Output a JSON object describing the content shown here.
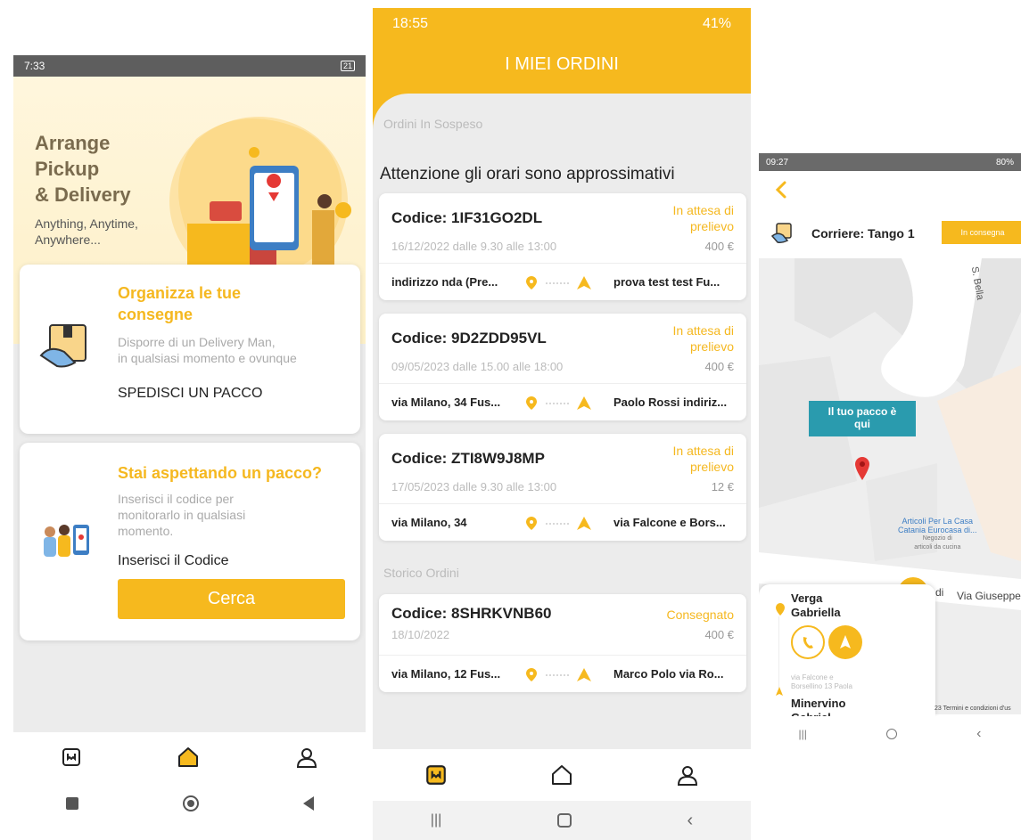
{
  "colors": {
    "accent": "#f6b91e",
    "tooltip": "#2a9bae",
    "pin": "#e53935"
  },
  "phone1": {
    "status": {
      "time": "7:33",
      "right": "21"
    },
    "hero": {
      "title_l1": "Arrange",
      "title_l2": "Pickup",
      "title_l3": "& Delivery",
      "sub_l1": "Anything, Anytime,",
      "sub_l2": "Anywhere..."
    },
    "card1": {
      "title_l1": "Organizza le tue",
      "title_l2": "consegne",
      "desc_l1": "Disporre di un Delivery Man,",
      "desc_l2": "in qualsiasi momento e ovunque",
      "cta": "SPEDISCI UN PACCO"
    },
    "card2": {
      "title": "Stai aspettando un pacco?",
      "desc_l1": "Inserisci il codice per",
      "desc_l2": "monitorarlo in qualsiasi",
      "desc_l3": "momento.",
      "input_label": "Inserisci il Codice",
      "button": "Cerca"
    },
    "tabs": [
      "orders-icon",
      "home-icon",
      "profile-icon"
    ]
  },
  "phone2": {
    "status": {
      "time": "18:55",
      "right": "41%"
    },
    "title": "I MIEI ORDINI",
    "pending_label": "Ordini In Sospeso",
    "notice": "Attenzione gli orari sono approssimativi",
    "history_label": "Storico Ordini",
    "orders": [
      {
        "code": "Codice: 1IF31GO2DL",
        "status_l1": "In attesa di",
        "status_l2": "prelievo",
        "date": "16/12/2022 dalle 9.30 alle 13:00",
        "price": "400 €",
        "from": "indirizzo nda (Pre...",
        "to": "prova test test Fu..."
      },
      {
        "code": "Codice: 9D2ZDD95VL",
        "status_l1": "In attesa di",
        "status_l2": "prelievo",
        "date": "09/05/2023 dalle 15.00 alle 18:00",
        "price": "400 €",
        "from": "via Milano, 34 Fus...",
        "to": "Paolo Rossi indiriz..."
      },
      {
        "code": "Codice: ZTI8W9J8MP",
        "status_l1": "In attesa di",
        "status_l2": "prelievo",
        "date": "17/05/2023 dalle 9.30 alle 13:00",
        "price": "12 €",
        "from": "via Milano, 34",
        "to": "via Falcone e Bors..."
      }
    ],
    "history": [
      {
        "code": "Codice: 8SHRKVNB60",
        "status": "Consegnato",
        "date": "18/10/2022",
        "price": "400 €",
        "from": "via Milano, 12 Fus...",
        "to": "Marco Polo via Ro..."
      }
    ]
  },
  "phone3": {
    "status": {
      "time": "09:27",
      "right": "80%"
    },
    "courier": "Corriere: Tango 1",
    "badge": "In consegna",
    "map": {
      "tooltip_l1": "Il tuo pacco è",
      "tooltip_l2": "qui",
      "street_top": "S. Bella",
      "street_bottom": "Via Giuseppe",
      "street_di": "di",
      "poi_l1": "Articoli Per La Casa",
      "poi_l2": "Catania Eurocasa di...",
      "poi_l3": "Negozio di",
      "poi_l4": "articoli da cucina",
      "terms": "23   Termini e condizioni d'us"
    },
    "sheet": {
      "from_l1": "Verga",
      "from_l2": "Gabriella",
      "addr_l1": "via Falcone e",
      "addr_l2": "Borsellino 13 Paola",
      "to_l1": "Minervino",
      "to_l2": "Gabriel"
    }
  }
}
